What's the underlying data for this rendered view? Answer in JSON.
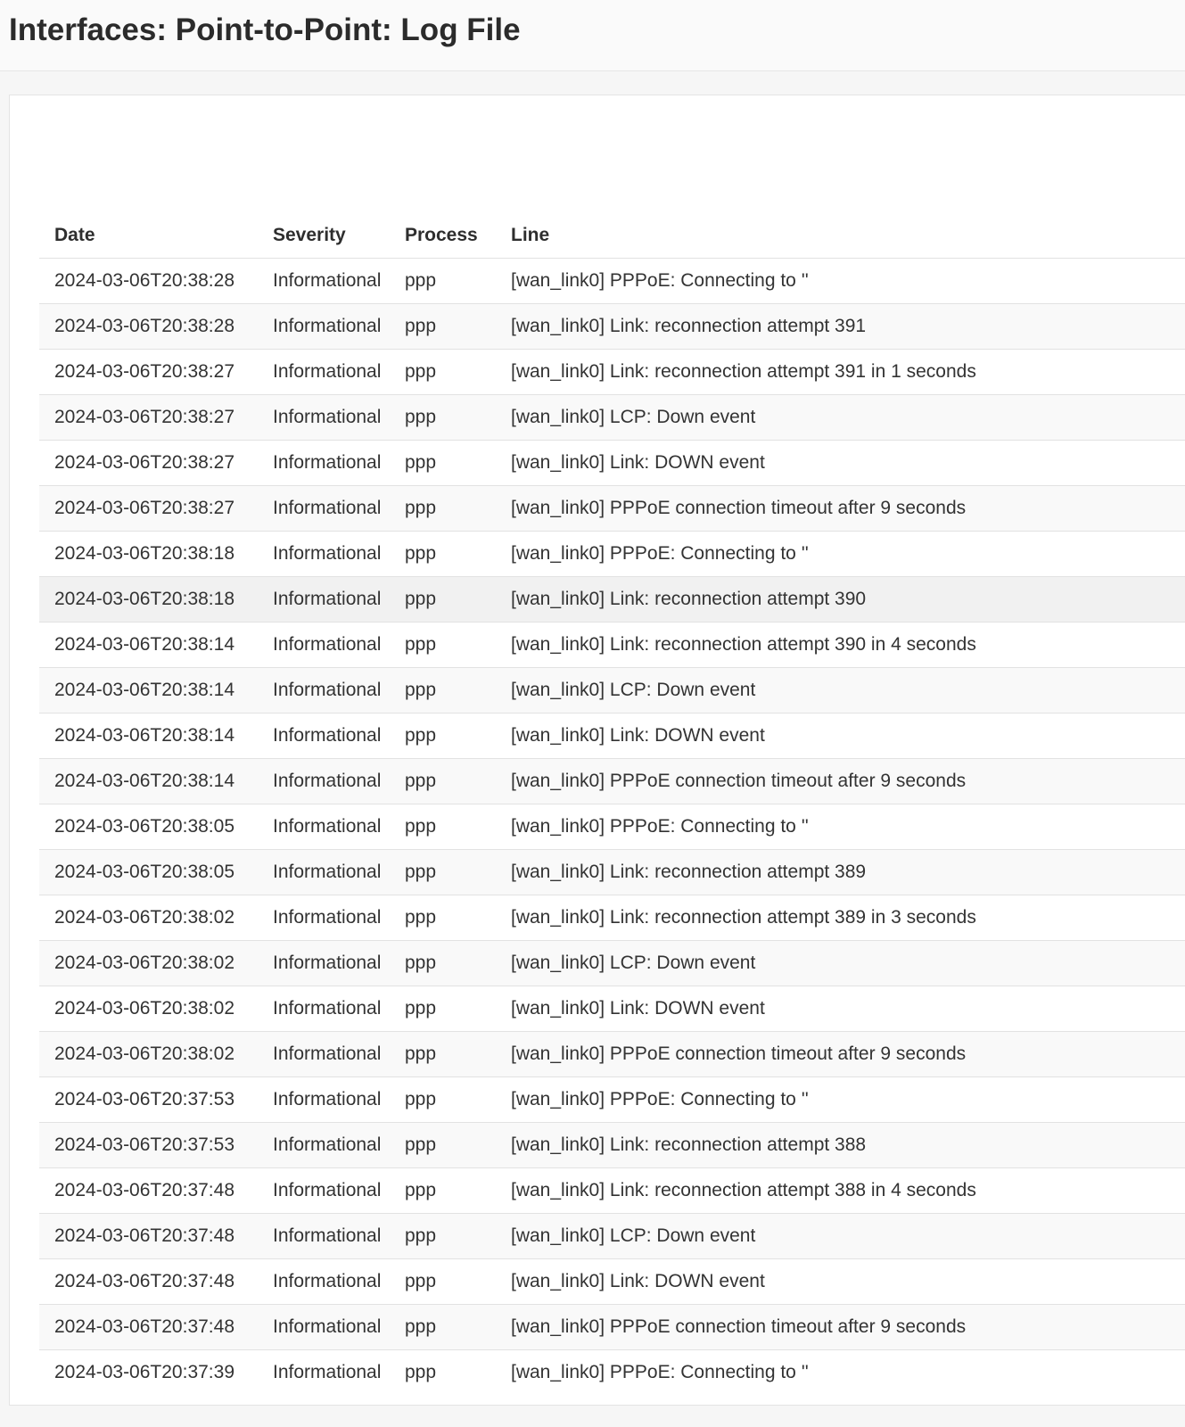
{
  "header": {
    "title": "Interfaces: Point-to-Point: Log File"
  },
  "table": {
    "columns": {
      "date": "Date",
      "severity": "Severity",
      "process": "Process",
      "line": "Line"
    },
    "rows": [
      {
        "date": "2024-03-06T20:38:28",
        "severity": "Informational",
        "process": "ppp",
        "line": "[wan_link0] PPPoE: Connecting to ''"
      },
      {
        "date": "2024-03-06T20:38:28",
        "severity": "Informational",
        "process": "ppp",
        "line": "[wan_link0] Link: reconnection attempt 391"
      },
      {
        "date": "2024-03-06T20:38:27",
        "severity": "Informational",
        "process": "ppp",
        "line": "[wan_link0] Link: reconnection attempt 391 in 1 seconds"
      },
      {
        "date": "2024-03-06T20:38:27",
        "severity": "Informational",
        "process": "ppp",
        "line": "[wan_link0] LCP: Down event"
      },
      {
        "date": "2024-03-06T20:38:27",
        "severity": "Informational",
        "process": "ppp",
        "line": "[wan_link0] Link: DOWN event"
      },
      {
        "date": "2024-03-06T20:38:27",
        "severity": "Informational",
        "process": "ppp",
        "line": "[wan_link0] PPPoE connection timeout after 9 seconds"
      },
      {
        "date": "2024-03-06T20:38:18",
        "severity": "Informational",
        "process": "ppp",
        "line": "[wan_link0] PPPoE: Connecting to ''"
      },
      {
        "date": "2024-03-06T20:38:18",
        "severity": "Informational",
        "process": "ppp",
        "line": "[wan_link0] Link: reconnection attempt 390"
      },
      {
        "date": "2024-03-06T20:38:14",
        "severity": "Informational",
        "process": "ppp",
        "line": "[wan_link0] Link: reconnection attempt 390 in 4 seconds"
      },
      {
        "date": "2024-03-06T20:38:14",
        "severity": "Informational",
        "process": "ppp",
        "line": "[wan_link0] LCP: Down event"
      },
      {
        "date": "2024-03-06T20:38:14",
        "severity": "Informational",
        "process": "ppp",
        "line": "[wan_link0] Link: DOWN event"
      },
      {
        "date": "2024-03-06T20:38:14",
        "severity": "Informational",
        "process": "ppp",
        "line": "[wan_link0] PPPoE connection timeout after 9 seconds"
      },
      {
        "date": "2024-03-06T20:38:05",
        "severity": "Informational",
        "process": "ppp",
        "line": "[wan_link0] PPPoE: Connecting to ''"
      },
      {
        "date": "2024-03-06T20:38:05",
        "severity": "Informational",
        "process": "ppp",
        "line": "[wan_link0] Link: reconnection attempt 389"
      },
      {
        "date": "2024-03-06T20:38:02",
        "severity": "Informational",
        "process": "ppp",
        "line": "[wan_link0] Link: reconnection attempt 389 in 3 seconds"
      },
      {
        "date": "2024-03-06T20:38:02",
        "severity": "Informational",
        "process": "ppp",
        "line": "[wan_link0] LCP: Down event"
      },
      {
        "date": "2024-03-06T20:38:02",
        "severity": "Informational",
        "process": "ppp",
        "line": "[wan_link0] Link: DOWN event"
      },
      {
        "date": "2024-03-06T20:38:02",
        "severity": "Informational",
        "process": "ppp",
        "line": "[wan_link0] PPPoE connection timeout after 9 seconds"
      },
      {
        "date": "2024-03-06T20:37:53",
        "severity": "Informational",
        "process": "ppp",
        "line": "[wan_link0] PPPoE: Connecting to ''"
      },
      {
        "date": "2024-03-06T20:37:53",
        "severity": "Informational",
        "process": "ppp",
        "line": "[wan_link0] Link: reconnection attempt 388"
      },
      {
        "date": "2024-03-06T20:37:48",
        "severity": "Informational",
        "process": "ppp",
        "line": "[wan_link0] Link: reconnection attempt 388 in 4 seconds"
      },
      {
        "date": "2024-03-06T20:37:48",
        "severity": "Informational",
        "process": "ppp",
        "line": "[wan_link0] LCP: Down event"
      },
      {
        "date": "2024-03-06T20:37:48",
        "severity": "Informational",
        "process": "ppp",
        "line": "[wan_link0] Link: DOWN event"
      },
      {
        "date": "2024-03-06T20:37:48",
        "severity": "Informational",
        "process": "ppp",
        "line": "[wan_link0] PPPoE connection timeout after 9 seconds"
      },
      {
        "date": "2024-03-06T20:37:39",
        "severity": "Informational",
        "process": "ppp",
        "line": "[wan_link0] PPPoE: Connecting to ''"
      }
    ],
    "hovered_row_index": 7
  }
}
